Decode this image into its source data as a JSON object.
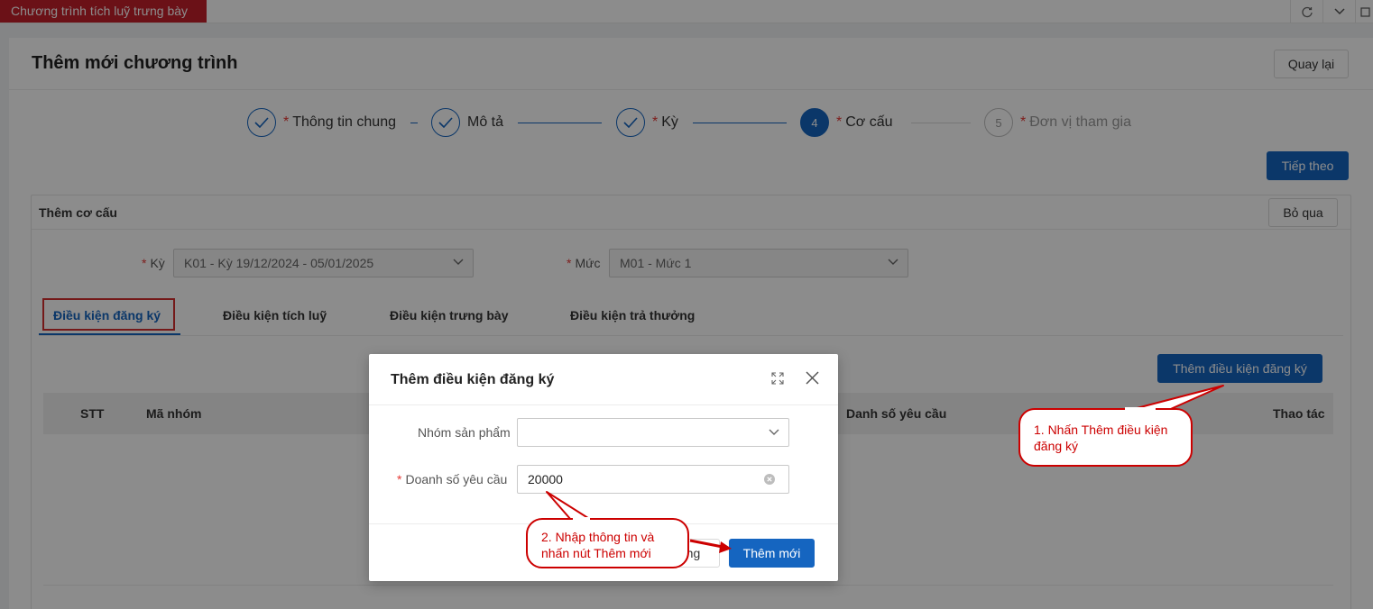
{
  "topbar": {
    "app_tab": "Chương trình tích luỹ trưng bày"
  },
  "header": {
    "title": "Thêm mới chương trình",
    "back_label": "Quay lại"
  },
  "steps": [
    {
      "number": "1",
      "label": "Thông tin chung",
      "required": "*"
    },
    {
      "number": "2",
      "label": "Mô tả",
      "required": ""
    },
    {
      "number": "3",
      "label": "Kỳ",
      "required": "*"
    },
    {
      "number": "4",
      "label": "Cơ cấu",
      "required": "*"
    },
    {
      "number": "5",
      "label": "Đơn vị tham gia",
      "required": "*"
    }
  ],
  "next_label": "Tiếp theo",
  "section": {
    "title": "Thêm cơ cấu",
    "skip_label": "Bỏ qua",
    "period_label": "Kỳ",
    "period_value": "K01 - Kỳ 19/12/2024 - 05/01/2025",
    "level_label": "Mức",
    "level_value": "M01 - Mức 1",
    "required_mark": "*"
  },
  "tabs": [
    "Điều kiện đăng ký",
    "Điều kiện tích luỹ",
    "Điều kiện trưng bày",
    "Điều kiện trả thưởng"
  ],
  "add_condition_label": "Thêm điều kiện đăng ký",
  "table": {
    "columns": [
      "STT",
      "Mã nhóm",
      "Danh số yêu cầu",
      "Thao tác"
    ]
  },
  "modal": {
    "title": "Thêm điều kiện đăng ký",
    "product_group_label": "Nhóm sản phẩm",
    "product_group_value": "",
    "revenue_label": "Doanh số yêu cầu",
    "revenue_value": "20000",
    "required_mark": "*",
    "cancel_label": "Đóng",
    "submit_label": "Thêm mới"
  },
  "callouts": {
    "one": "1. Nhấn Thêm điều kiện đăng ký",
    "two": "2. Nhập thông tin và nhấn nút Thêm mới"
  },
  "colors": {
    "brand_red": "#c41f2a",
    "primary": "#1565c0",
    "annotation": "#cc0000"
  }
}
